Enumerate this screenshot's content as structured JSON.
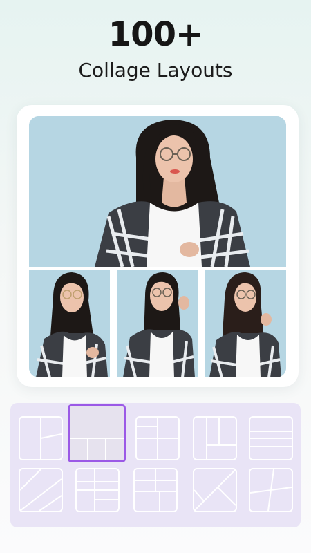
{
  "header": {
    "title": "100+",
    "subtitle": "Collage Layouts"
  },
  "collage": {
    "photos": [
      {
        "name": "large-top-photo"
      },
      {
        "name": "bottom-left-photo"
      },
      {
        "name": "bottom-middle-photo"
      },
      {
        "name": "bottom-right-photo"
      }
    ]
  },
  "layout_picker": {
    "selected_index": 1,
    "layouts": [
      {
        "name": "two-column-split-right"
      },
      {
        "name": "big-top-three-bottom"
      },
      {
        "name": "four-grid-tall-bottom"
      },
      {
        "name": "left-column-split-right"
      },
      {
        "name": "four-horizontal-rows"
      },
      {
        "name": "diagonal-stripes"
      },
      {
        "name": "column-and-rows"
      },
      {
        "name": "grid-with-strip"
      },
      {
        "name": "diagonal-cross"
      },
      {
        "name": "tilted-quadrants"
      }
    ]
  },
  "colors": {
    "accent": "#9b59e6",
    "panel": "#e9e4f6",
    "photo_background": "#b7d7e4"
  }
}
